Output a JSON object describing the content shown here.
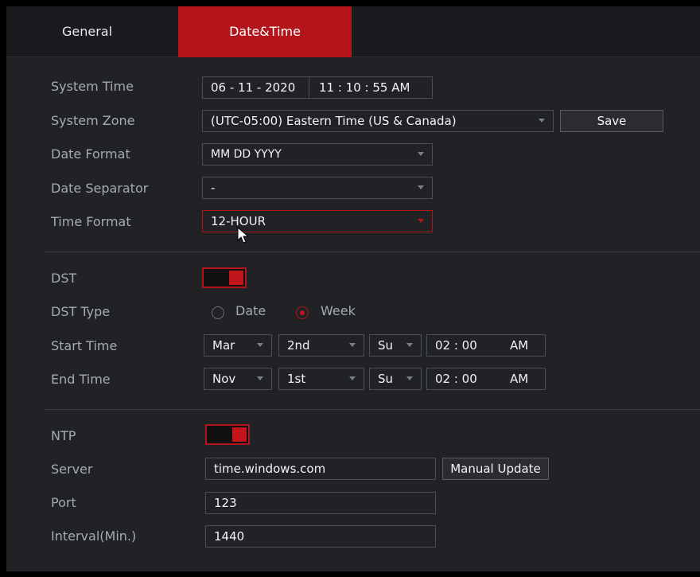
{
  "tabs": {
    "general": "General",
    "date_time": "Date&Time"
  },
  "system_time": {
    "label": "System Time",
    "date": "06 - 11 - 2020",
    "time": "11 : 10 : 55  AM"
  },
  "system_zone": {
    "label": "System Zone",
    "value": "(UTC-05:00) Eastern Time (US & Canada)",
    "save": "Save"
  },
  "date_format": {
    "label": "Date Format",
    "value": "MM DD YYYY"
  },
  "date_separator": {
    "label": "Date Separator",
    "value": "-"
  },
  "time_format": {
    "label": "Time Format",
    "value": "12-HOUR"
  },
  "dst": {
    "label": "DST",
    "enabled": true,
    "type_label": "DST Type",
    "options": [
      "Date",
      "Week"
    ],
    "selected": "Week",
    "start": {
      "label": "Start Time",
      "month": "Mar",
      "week": "2nd",
      "day": "Su",
      "time": "02 : 00",
      "ampm": "AM"
    },
    "end": {
      "label": "End Time",
      "month": "Nov",
      "week": "1st",
      "day": "Su",
      "time": "02 : 00",
      "ampm": "AM"
    }
  },
  "ntp": {
    "label": "NTP",
    "enabled": true,
    "server_label": "Server",
    "server": "time.windows.com",
    "manual_update": "Manual Update",
    "port_label": "Port",
    "port": "123",
    "interval_label": "Interval(Min.)",
    "interval": "1440"
  },
  "colors": {
    "accent": "#b3151b",
    "panel": "#202226",
    "border": "#4a4d53"
  }
}
